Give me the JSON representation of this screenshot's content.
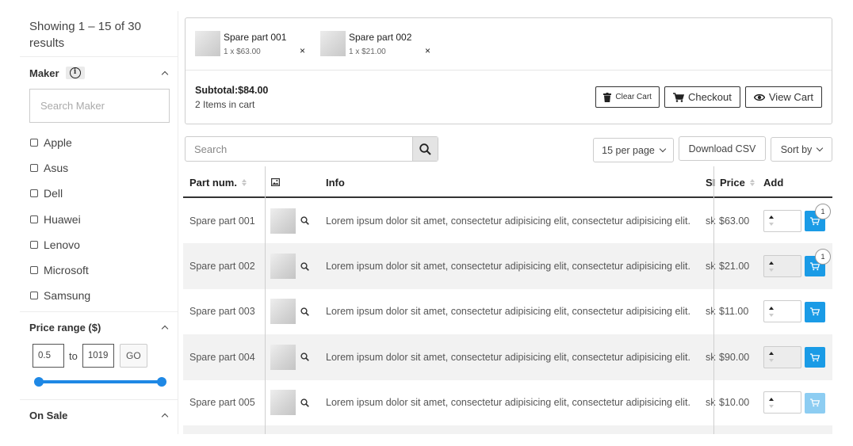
{
  "sidebar": {
    "showing": "Showing 1 – 15 of 30 results",
    "maker": {
      "title": "Maker",
      "search_placeholder": "Search Maker",
      "items": [
        "Apple",
        "Asus",
        "Dell",
        "Huawei",
        "Lenovo",
        "Microsoft",
        "Samsung"
      ]
    },
    "price": {
      "title": "Price range ($)",
      "min": "0.5",
      "to": "to",
      "max": "1019",
      "go": "GO"
    },
    "on_sale": {
      "title": "On Sale"
    }
  },
  "cart": {
    "items": [
      {
        "name": "Spare part 001",
        "qty_price": "1 x $63.00",
        "remove": "×"
      },
      {
        "name": "Spare part 002",
        "qty_price": "1 x $21.00",
        "remove": "×"
      }
    ],
    "subtotal": "Subtotal:$84.00",
    "items_count": "2 Items in cart",
    "clear_label": "Clear Cart",
    "checkout_label": "Checkout",
    "view_label": "View Cart"
  },
  "toolbar": {
    "search_placeholder": "Search",
    "per_page": "15 per page",
    "download": "Download CSV",
    "sort": "Sort by"
  },
  "table": {
    "columns": {
      "part": "Part num.",
      "info": "Info",
      "sku": "SI",
      "price": "Price",
      "add": "Add"
    },
    "rows": [
      {
        "part": "Spare part 001",
        "info": "Lorem ipsum dolor sit amet, consectetur adipisicing elit, consectetur adipisicing elit.",
        "sku": "sk",
        "price": "$63.00",
        "badge": "1"
      },
      {
        "part": "Spare part 002",
        "info": "Lorem ipsum dolor sit amet, consectetur adipisicing elit, consectetur adipisicing elit.",
        "sku": "sk",
        "price": "$21.00",
        "badge": "1"
      },
      {
        "part": "Spare part 003",
        "info": "Lorem ipsum dolor sit amet, consectetur adipisicing elit, consectetur adipisicing elit.",
        "sku": "sk",
        "price": "$11.00",
        "badge": null
      },
      {
        "part": "Spare part 004",
        "info": "Lorem ipsum dolor sit amet, consectetur adipisicing elit, consectetur adipisicing elit.",
        "sku": "sk",
        "price": "$90.00",
        "badge": null
      },
      {
        "part": "Spare part 005",
        "info": "Lorem ipsum dolor sit amet, consectetur adipisicing elit, consectetur adipisicing elit.",
        "sku": "sk",
        "price": "$10.00",
        "badge": null
      }
    ]
  },
  "colors": {
    "accent": "#1a9be6",
    "slider": "#1e88e5"
  }
}
